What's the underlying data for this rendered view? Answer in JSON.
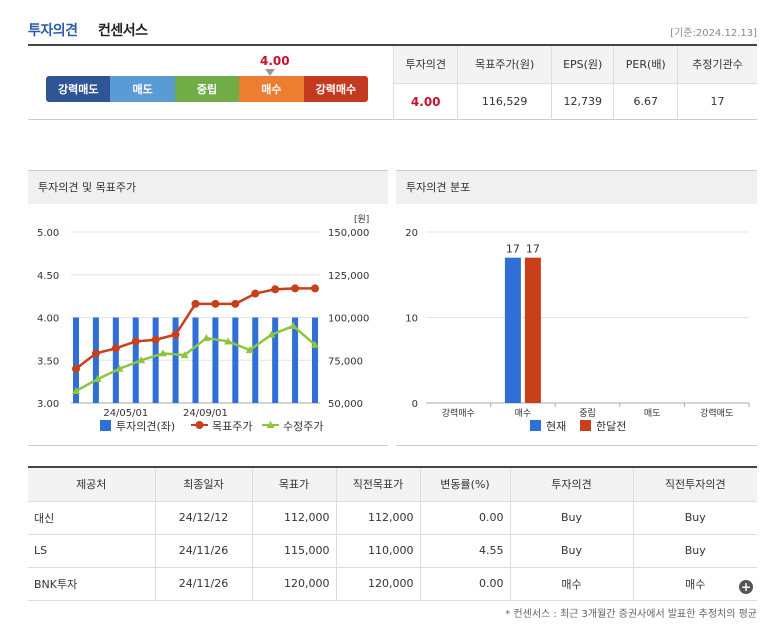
{
  "header": {
    "title_main": "투자의견",
    "title_sub": "컨센서스",
    "base_date": "[기준:2024.12.13]"
  },
  "gauge": {
    "value": "4.00",
    "value_num": 4.0,
    "segments": [
      {
        "label": "강력매도",
        "color": "#2f5597"
      },
      {
        "label": "매도",
        "color": "#5b9bd5"
      },
      {
        "label": "중립",
        "color": "#70ad47"
      },
      {
        "label": "매수",
        "color": "#ed7d31"
      },
      {
        "label": "강력매수",
        "color": "#c43a20"
      }
    ]
  },
  "summary": {
    "headers": [
      "투자의견",
      "목표주가(원)",
      "EPS(원)",
      "PER(배)",
      "추정기관수"
    ],
    "values": [
      "4.00",
      "116,529",
      "12,739",
      "6.67",
      "17"
    ]
  },
  "left_panel": {
    "title": "투자의견 및 목표주가"
  },
  "right_panel": {
    "title": "투자의견 분포"
  },
  "chart_data": [
    {
      "type": "bar",
      "title": "투자의견 및 목표주가",
      "unit_label": "[원]",
      "x_ticks": [
        "24/05/01",
        "24/09/01"
      ],
      "y_left": {
        "ticks": [
          "5.00",
          "4.50",
          "4.00",
          "3.50",
          "3.00"
        ],
        "lim": [
          3.0,
          5.0
        ]
      },
      "y_right": {
        "ticks": [
          "150,000",
          "125,000",
          "100,000",
          "75,000",
          "50,000"
        ],
        "lim": [
          50000,
          150000
        ]
      },
      "n_points": 12,
      "series": [
        {
          "name": "투자의견(좌)",
          "kind": "bar",
          "axis": "left",
          "color": "#2f6fd6",
          "values": [
            4.0,
            4.0,
            4.0,
            4.0,
            4.0,
            4.0,
            4.0,
            4.0,
            4.0,
            4.0,
            4.0,
            4.0,
            4.0
          ]
        },
        {
          "name": "목표주가",
          "kind": "line",
          "axis": "right",
          "color": "#c8401a",
          "values": [
            70000,
            79000,
            82000,
            86000,
            87000,
            90000,
            108000,
            108000,
            108000,
            114000,
            116500,
            117000,
            117000
          ]
        },
        {
          "name": "수정주가",
          "kind": "line",
          "axis": "right",
          "color": "#8cc63f",
          "values": [
            57000,
            64000,
            70000,
            75000,
            79000,
            78000,
            88000,
            86000,
            81000,
            90000,
            95000,
            84000
          ]
        }
      ],
      "legend": [
        "투자의견(좌)",
        "목표주가",
        "수정주가"
      ]
    },
    {
      "type": "bar",
      "title": "투자의견 분포",
      "categories": [
        "강력매수",
        "매수",
        "중립",
        "매도",
        "강력매도"
      ],
      "ylim": [
        0,
        20
      ],
      "y_ticks": [
        "20",
        "10",
        "0"
      ],
      "series": [
        {
          "name": "현재",
          "color": "#2f6fd6",
          "values": [
            0,
            17,
            0,
            0,
            0
          ]
        },
        {
          "name": "한달전",
          "color": "#c8401a",
          "values": [
            0,
            17,
            0,
            0,
            0
          ]
        }
      ],
      "data_labels": [
        "17",
        "17"
      ],
      "legend": [
        "현재",
        "한달전"
      ]
    }
  ],
  "table": {
    "headers": [
      "제공처",
      "최종일자",
      "목표가",
      "직전목표가",
      "변동률(%)",
      "투자의견",
      "직전투자의견"
    ],
    "rows": [
      [
        "대신",
        "24/12/12",
        "112,000",
        "112,000",
        "0.00",
        "Buy",
        "Buy"
      ],
      [
        "LS",
        "24/11/26",
        "115,000",
        "110,000",
        "4.55",
        "Buy",
        "Buy"
      ],
      [
        "BNK투자",
        "24/11/26",
        "120,000",
        "120,000",
        "0.00",
        "매수",
        "매수"
      ]
    ]
  },
  "more_button": "+",
  "footnote": "* 컨센서스 : 최근 3개월간 증권사에서 발표한 추정치의 평균"
}
